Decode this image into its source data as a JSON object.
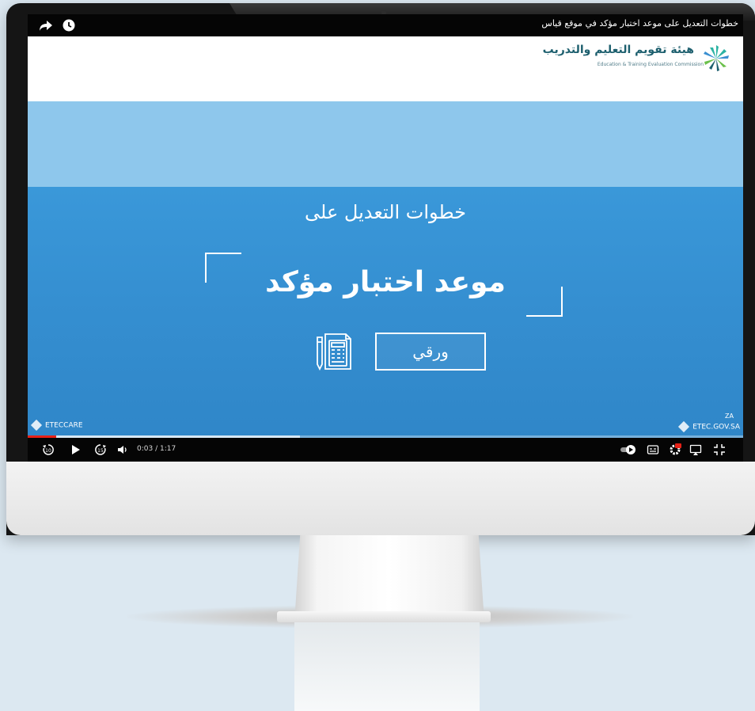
{
  "video": {
    "title": "خطوات التعديل على موعد اختبار مؤكد في موقع قياس",
    "time_display": "0:03 / 1:17",
    "progress": 0.04,
    "buffered": 0.38
  },
  "logo": {
    "arabic": "هيئة تقويم التعليم والتدريب",
    "english": "Education & Training Evaluation Commission"
  },
  "slide": {
    "subtitle": "خطوات التعديل على",
    "headline": "موعد اختبار مؤكد",
    "paper_button": "ورقي",
    "brand_left": "ETECCARE",
    "brand_right": "ETEC.GOV.SA",
    "corner_tag": "ZA"
  },
  "icons": {
    "share": "share-icon",
    "watch_later": "clock-icon",
    "rewind": "rewind-10-icon",
    "play": "play-icon",
    "forward": "forward-15-icon",
    "volume": "volume-icon",
    "autoplay": "autoplay-toggle-icon",
    "captions": "captions-icon",
    "settings": "settings-hd-icon",
    "cast": "cast-icon",
    "fullscreen": "exit-fullscreen-icon",
    "document": "document-icon"
  },
  "colors": {
    "band_light": "#8ec7ec",
    "band_main": "#3a98d9",
    "progress": "#e62117",
    "logo_text": "#1d5f6e"
  }
}
